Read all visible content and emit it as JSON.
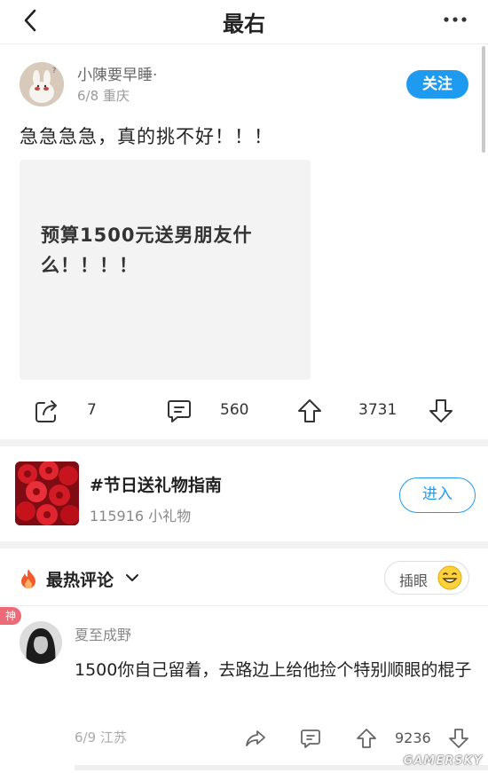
{
  "nav": {
    "title": "最右",
    "back_icon": "chevron-left-icon",
    "more_icon": "more-horizontal-icon"
  },
  "post": {
    "author": "小陳要早睡·",
    "meta": "6/8 重庆",
    "follow_label": "关注",
    "text": "急急急急，真的挑不好！！！",
    "card_text": "预算1500元送男朋友什么！！！！",
    "actions": {
      "share_count": "7",
      "comment_count": "560",
      "upvote_count": "3731"
    }
  },
  "topic": {
    "title": "#节日送礼物指南",
    "subtitle": "115916 小礼物",
    "enter_label": "进入"
  },
  "comments": {
    "sort_label": "最热评论",
    "insert_label": "插眼",
    "items": [
      {
        "badge": "神",
        "name": "夏至成野",
        "text": "1500你自己留着，去路边上给他捡个特别顺眼的棍子",
        "meta": "6/9 江苏",
        "upvotes": "9236"
      }
    ]
  },
  "watermark": "GAMERSKY",
  "colors": {
    "accent": "#1e9bf0",
    "badge": "#ef6a78",
    "fire": "#f25b2a"
  }
}
